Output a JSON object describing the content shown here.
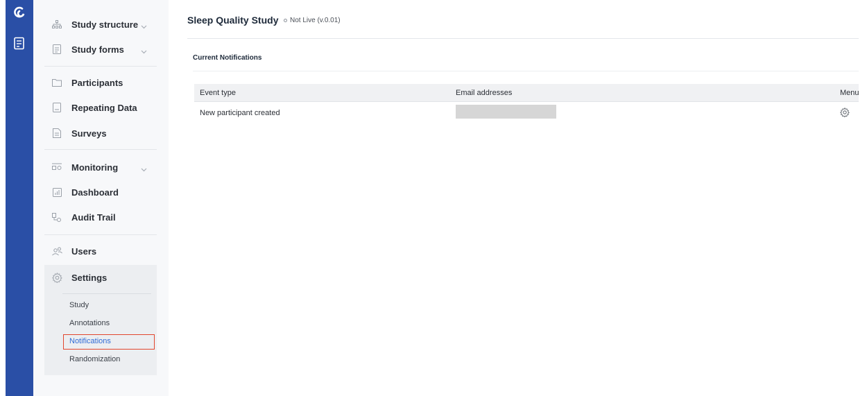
{
  "rail": {
    "logo_icon": "app-logo-icon",
    "forms_icon": "forms-book-icon"
  },
  "sidebar": {
    "items": [
      {
        "label": "Study structure",
        "icon": "hierarchy-icon",
        "has_chevron": true
      },
      {
        "label": "Study forms",
        "icon": "form-icon",
        "has_chevron": true
      },
      {
        "label": "Participants",
        "icon": "folder-icon",
        "has_chevron": false
      },
      {
        "label": "Repeating Data",
        "icon": "doc-icon",
        "has_chevron": false
      },
      {
        "label": "Surveys",
        "icon": "survey-icon",
        "has_chevron": false
      },
      {
        "label": "Monitoring",
        "icon": "monitoring-icon",
        "has_chevron": true
      },
      {
        "label": "Dashboard",
        "icon": "chart-icon",
        "has_chevron": false
      },
      {
        "label": "Audit Trail",
        "icon": "audit-icon",
        "has_chevron": false
      },
      {
        "label": "Users",
        "icon": "users-icon",
        "has_chevron": false
      },
      {
        "label": "Settings",
        "icon": "gear-icon",
        "has_chevron": false
      }
    ],
    "settings_sub": [
      {
        "label": "Study",
        "active": false
      },
      {
        "label": "Annotations",
        "active": false
      },
      {
        "label": "Notifications",
        "active": true
      },
      {
        "label": "Randomization",
        "active": false
      }
    ]
  },
  "header": {
    "study_title": "Sleep Quality Study",
    "status": "Not Live (v.0.01)"
  },
  "section": {
    "title": "Current Notifications"
  },
  "table": {
    "columns": [
      "Event type",
      "Email addresses",
      "Menu"
    ],
    "rows": [
      {
        "event_type": "New participant created",
        "email": "",
        "menu_icon": "gear-icon"
      }
    ]
  },
  "colors": {
    "rail": "#2a4fa6",
    "active_link": "#2f6bd6",
    "highlight_border": "#e2452d"
  }
}
